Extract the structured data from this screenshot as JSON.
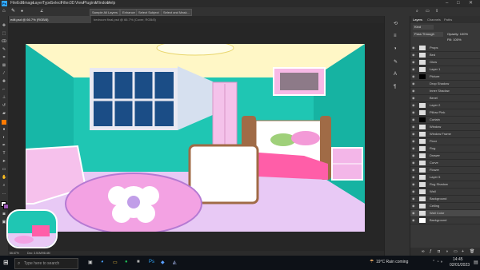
{
  "menubar": {
    "logo": "Ps",
    "items": [
      "File",
      "Edit",
      "Image",
      "Layer",
      "Type",
      "Select",
      "Filter",
      "3D",
      "View",
      "Plugins",
      "Window",
      "Help"
    ]
  },
  "optionsbar": {
    "buttons": [
      "Sample All Layers",
      "Enhance Edge",
      "Select Subject",
      "Select and Mask..."
    ]
  },
  "tabs": [
    {
      "label": "edit.psd @ 66.7% (RGB/8)",
      "active": true
    },
    {
      "label": "bedroom final.psd @ 66.7% (Cover, RGB/8)",
      "active": false
    }
  ],
  "statusbar": {
    "zoom": "66.67%",
    "doc": "Doc: 3.51M/98.4M"
  },
  "panels": {
    "tabs": [
      "Layers",
      "Channels",
      "Paths"
    ],
    "kind_label": "Kind",
    "blend_mode": "Pass Through",
    "opacity_label": "Opacity: 100%",
    "fill_label": "Fill: 100%",
    "layers": [
      "Props",
      "Bed",
      "Glow",
      "Layer 1",
      "Picture",
      "Drop Shadow",
      "Inner Shadow",
      "Bevel",
      "Layer 2",
      "Pillow Pink",
      "Curtain",
      "Window",
      "Window Frame",
      "Floor",
      "Rug",
      "Drawer",
      "Curve",
      "Flower",
      "Layer 5",
      "Rug Shadow",
      "Wall",
      "Background",
      "Ceiling",
      "Wall Color",
      "Background"
    ],
    "footer_icons": [
      "link-icon",
      "fx-icon",
      "mask-icon",
      "adjust-icon",
      "folder-icon",
      "new-layer-icon",
      "trash-icon"
    ]
  },
  "taskbar": {
    "search_placeholder": "Type here to search",
    "weather": "19°C  Rain coming",
    "time": "14:45",
    "date": "02/01/2023"
  },
  "colors": {
    "wall": "#1fc6b3",
    "floor": "#e8c9f5",
    "bed_pink": "#ff5ea8",
    "ps_blue": "#31a8ff"
  }
}
